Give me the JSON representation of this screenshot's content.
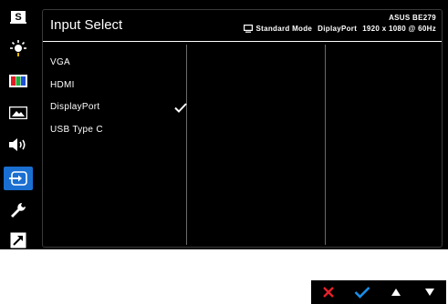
{
  "sidebar": {
    "items": [
      {
        "id": "splendid",
        "icon": "splendid-s-icon",
        "active": false
      },
      {
        "id": "blue-light",
        "icon": "blue-light-filter-icon",
        "active": false
      },
      {
        "id": "color",
        "icon": "color-bars-icon",
        "active": false
      },
      {
        "id": "image",
        "icon": "image-landscape-icon",
        "active": false
      },
      {
        "id": "sound",
        "icon": "speaker-icon",
        "active": false
      },
      {
        "id": "input-select",
        "icon": "input-select-icon",
        "active": true
      },
      {
        "id": "system-setup",
        "icon": "wrench-icon",
        "active": false
      },
      {
        "id": "shortcut",
        "icon": "shortcut-arrow-icon",
        "active": false
      }
    ]
  },
  "header": {
    "title": "Input Select",
    "model": "ASUS BE279",
    "mode": "Standard Mode",
    "input": "DiplayPort",
    "resolution": "1920 x 1080 @ 60Hz"
  },
  "options": [
    {
      "label": "VGA",
      "selected": false
    },
    {
      "label": "HDMI",
      "selected": false
    },
    {
      "label": "DisplayPort",
      "selected": true
    },
    {
      "label": "USB Type C",
      "selected": false
    }
  ],
  "nav": [
    {
      "id": "close",
      "icon": "close-icon",
      "color": "#e8202a"
    },
    {
      "id": "confirm",
      "icon": "check-icon",
      "color": "#1a8fe8"
    },
    {
      "id": "up",
      "icon": "triangle-up-icon",
      "color": "#ffffff"
    },
    {
      "id": "down",
      "icon": "triangle-down-icon",
      "color": "#ffffff"
    }
  ],
  "colors": {
    "accent": "#1a6fd1",
    "background": "#000000",
    "text": "#ffffff"
  }
}
